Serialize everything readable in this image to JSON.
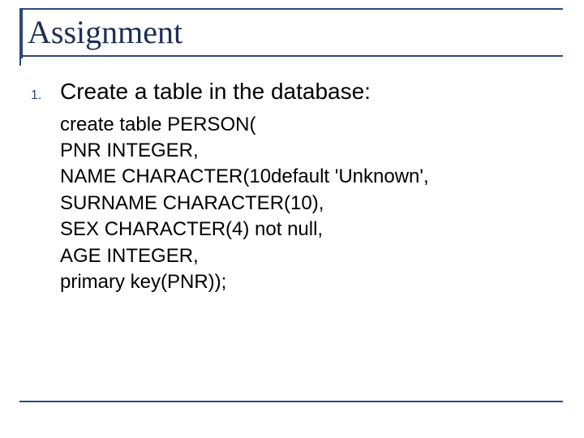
{
  "title": "Assignment",
  "list": {
    "items": [
      {
        "number": "1.",
        "text": "Create a table in the database:"
      }
    ]
  },
  "code": {
    "lines": [
      "create table PERSON(",
      "PNR INTEGER,",
      "NAME CHARACTER(10default 'Unknown',",
      "SURNAME CHARACTER(10),",
      "SEX CHARACTER(4) not null,",
      "AGE INTEGER,",
      "primary key(PNR));"
    ]
  }
}
